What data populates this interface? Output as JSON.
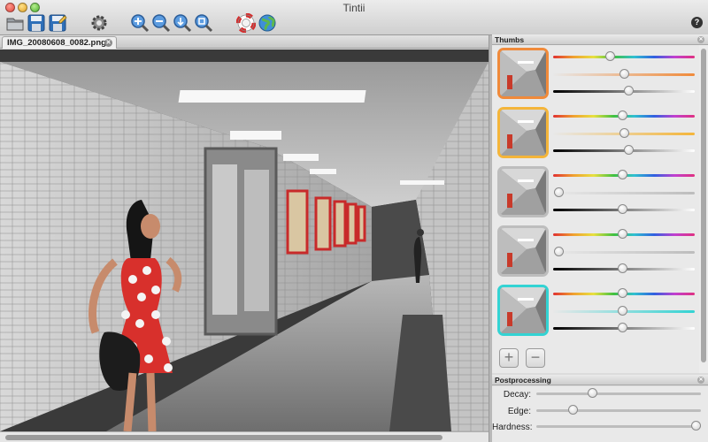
{
  "window": {
    "title": "Tintii"
  },
  "toolbar": {
    "buttons": [
      "open-icon",
      "save-icon",
      "save-as-icon",
      "preferences-icon",
      "zoom-in-icon",
      "zoom-out-icon",
      "zoom-fit-icon",
      "zoom-actual-icon",
      "help-lifebuoy-icon",
      "web-globe-icon"
    ],
    "help_label": "?"
  },
  "document": {
    "tab_label": "IMG_20080608_0082.png",
    "tab_close": "✕"
  },
  "thumbs_panel": {
    "title": "Thumbs",
    "close": "✕",
    "accent_colors": [
      "#f08a3a",
      "#f4b53a",
      "#bdbdbd",
      "#bdbdbd",
      "#33d3d3"
    ],
    "rows": [
      {
        "hue": 0.4,
        "saturation": 0.5,
        "value": 0.53,
        "selected": true
      },
      {
        "hue": 0.49,
        "saturation": 0.5,
        "value": 0.53,
        "selected": false
      },
      {
        "hue": 0.49,
        "saturation": 0.04,
        "value": 0.49,
        "selected": false
      },
      {
        "hue": 0.49,
        "saturation": 0.04,
        "value": 0.49,
        "selected": false
      },
      {
        "hue": 0.49,
        "saturation": 0.49,
        "value": 0.49,
        "selected": false
      }
    ],
    "add_label": "+",
    "remove_label": "−"
  },
  "postprocessing": {
    "title": "Postprocessing",
    "close": "✕",
    "sliders": [
      {
        "label": "Decay:",
        "value": 0.34
      },
      {
        "label": "Edge:",
        "value": 0.22
      },
      {
        "label": "Hardness:",
        "value": 1.0
      }
    ]
  }
}
